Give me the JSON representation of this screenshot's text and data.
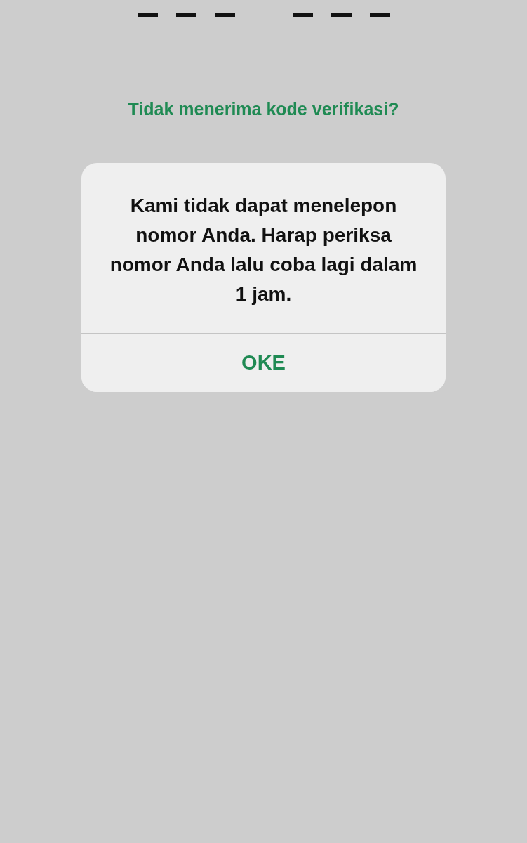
{
  "code_input": {
    "groups": [
      {
        "slots": [
          {
            "filled": false
          },
          {
            "filled": false
          },
          {
            "filled": false
          }
        ]
      },
      {
        "slots": [
          {
            "filled": false
          },
          {
            "filled": false
          },
          {
            "filled": false
          }
        ]
      }
    ]
  },
  "resend_link": "Tidak menerima kode verifikasi?",
  "alert": {
    "message": "Kami tidak dapat menelepon nomor Anda. Harap periksa nomor Anda lalu coba lagi dalam 1 jam.",
    "buttons": [
      "OKE"
    ]
  }
}
